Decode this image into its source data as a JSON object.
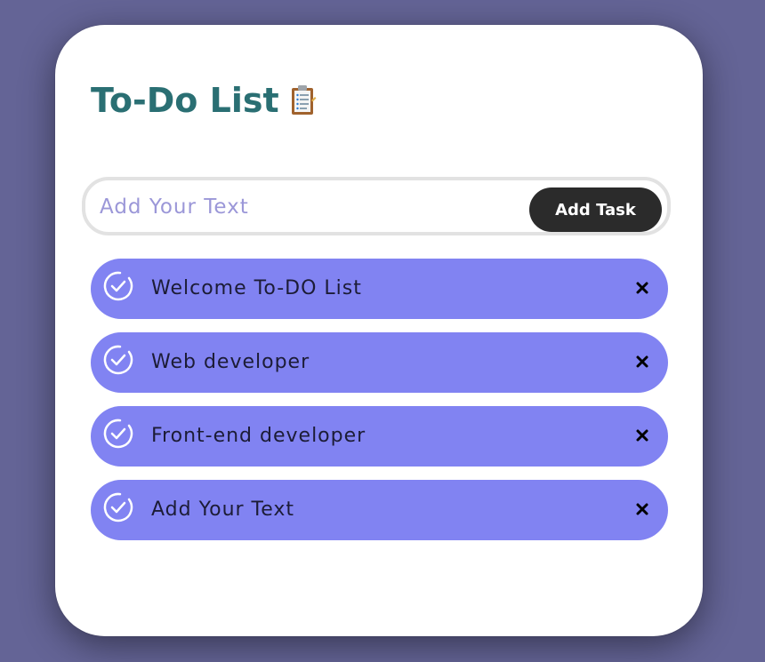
{
  "app": {
    "title": "To-Do List",
    "title_icon": "clipboard-icon"
  },
  "input": {
    "placeholder": "Add Your Text",
    "value": ""
  },
  "add_button": {
    "label": "Add Task"
  },
  "tasks": [
    {
      "text": "Welcome To-DO List",
      "icon": "check-circle-icon",
      "action_icon": "close-icon"
    },
    {
      "text": "Web developer",
      "icon": "check-circle-icon",
      "action_icon": "close-icon"
    },
    {
      "text": "Front-end developer",
      "icon": "check-circle-icon",
      "action_icon": "close-icon"
    },
    {
      "text": "Add Your Text",
      "icon": "check-circle-icon",
      "action_icon": "close-icon"
    }
  ],
  "colors": {
    "background": "#646496",
    "card": "#ffffff",
    "title": "#2a6f73",
    "task_pill": "#8183f2",
    "add_button": "#2b2b2b",
    "placeholder": "#9b97d8"
  }
}
